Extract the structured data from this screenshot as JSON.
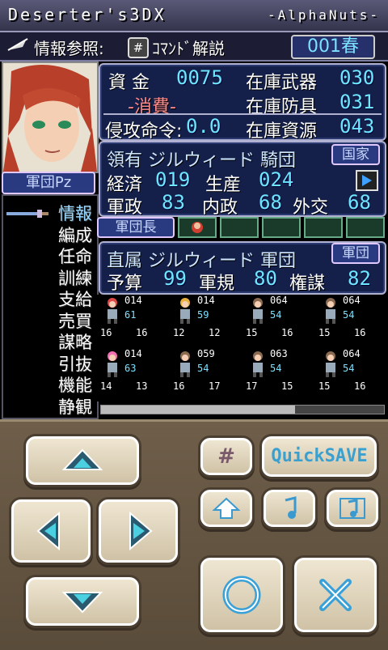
{
  "app": {
    "title": "Deserter's3DX",
    "developer": "-AlphaNuts-"
  },
  "infobar": {
    "label": "情報参照:",
    "help_icon": "#",
    "help_text": "ｺﾏﾝﾄﾞ解説",
    "turn": "001春"
  },
  "stats": {
    "money_label": "資 金",
    "money": "0075",
    "spend_label": "-消費-",
    "stock_weapons_label": "在庫武器",
    "stock_weapons": "030",
    "stock_armor_label": "在庫防具",
    "stock_armor": "031",
    "attack_label": "侵攻命令:",
    "attack": "0.0",
    "stock_res_label": "在庫資源",
    "stock_res": "043"
  },
  "territory": {
    "title": "領有 ジルウィード 騎団",
    "tag": "国家",
    "econ_label": "経済",
    "econ": "019",
    "prod_label": "生産",
    "prod": "024",
    "mil_label": "軍政",
    "mil": "83",
    "dom_label": "内政",
    "dom": "68",
    "dip_label": "外交",
    "dip": "68"
  },
  "legion": {
    "portrait_label": "軍団Pz",
    "leader_label": "軍団長",
    "title": "直属 ジルウィード 軍団",
    "tag": "軍団",
    "budget_label": "予算",
    "budget": "99",
    "disc_label": "軍規",
    "disc": "80",
    "plot_label": "権謀",
    "plot": "82"
  },
  "menu": [
    "情報",
    "編成",
    "任命",
    "訓練",
    "支給",
    "売買",
    "謀略",
    "引抜",
    "機能",
    "静観"
  ],
  "units": [
    {
      "lv": "014",
      "hp": "61",
      "a": "16",
      "d": "16",
      "color": "#e04848"
    },
    {
      "lv": "014",
      "hp": "59",
      "a": "12",
      "d": "12",
      "color": "#e8b040"
    },
    {
      "lv": "064",
      "hp": "54",
      "a": "15",
      "d": "16",
      "color": "#8a6a50"
    },
    {
      "lv": "064",
      "hp": "54",
      "a": "15",
      "d": "16",
      "color": "#8a6a50"
    },
    {
      "lv": "014",
      "hp": "63",
      "a": "14",
      "d": "13",
      "color": "#f070b0"
    },
    {
      "lv": "059",
      "hp": "54",
      "a": "16",
      "d": "17",
      "color": "#8a6a50"
    },
    {
      "lv": "063",
      "hp": "54",
      "a": "17",
      "d": "15",
      "color": "#8a6a50"
    },
    {
      "lv": "064",
      "hp": "54",
      "a": "15",
      "d": "16",
      "color": "#8a6a50"
    }
  ],
  "controls": {
    "hash": "#",
    "quicksave": "QuickSAVE"
  },
  "colors": {
    "accent": "#6ee6ff",
    "panel": "#15204a",
    "pad": "#6e5e4a"
  }
}
